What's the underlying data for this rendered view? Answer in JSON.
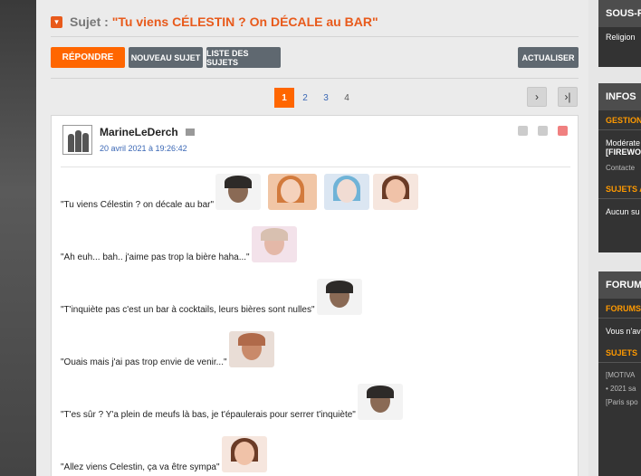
{
  "topic": {
    "prefix": "Sujet :",
    "title": "\"Tu viens CÉLESTIN ? On DÉCALE au BAR\""
  },
  "toolbar": {
    "reply": "RÉPONDRE",
    "new_topic": "NOUVEAU SUJET",
    "topic_list": "LISTE DES SUJETS",
    "refresh": "ACTUALISER"
  },
  "pagination": {
    "pages": [
      "1",
      "2",
      "3",
      "4"
    ],
    "current": "1",
    "next_label": "›",
    "last_label": "›|"
  },
  "post": {
    "author": "MarineLeDerch",
    "date": "20 avril 2021 à 19:26:42",
    "lines": [
      "\"Tu viens Célestin ? on décale au bar\"",
      "\"Ah euh... bah.. j'aime pas trop la bière haha...\"",
      "\"T'inquiète pas c'est un bar à cocktails, leurs bières sont nulles\"",
      "\"Ouais mais j'ai pas trop envie de venir...\"",
      "\"T'es sûr ? Y'a plein de meufs là bas, je t'épaulerais pour serrer t'inquiète\"",
      "\"Allez viens Celestin, ça va être sympa\""
    ]
  },
  "sidebar": {
    "sous_forums": {
      "title": "SOUS-F",
      "item": "Religion"
    },
    "infos": {
      "title": "INFOS",
      "gestion_title": "GESTION",
      "moderators_label": "Modérate",
      "moderators_value": "[FIREWO",
      "contact": "Contacte",
      "subjects_title": "SUJETS A",
      "subjects_none": "Aucun su"
    },
    "forums": {
      "title": "FORUMS",
      "forums_sub": "FORUMS",
      "forums_text": "Vous n'av",
      "subjects_title": "SUJETS",
      "item1": "[MOTIVA",
      "item2": "• 2021 sa",
      "item3": "[Paris spo"
    }
  },
  "colors": {
    "accent": "#ff6600",
    "link": "#3a67b5",
    "grey_button": "#5f6870",
    "sidebar_bg": "#333333"
  }
}
